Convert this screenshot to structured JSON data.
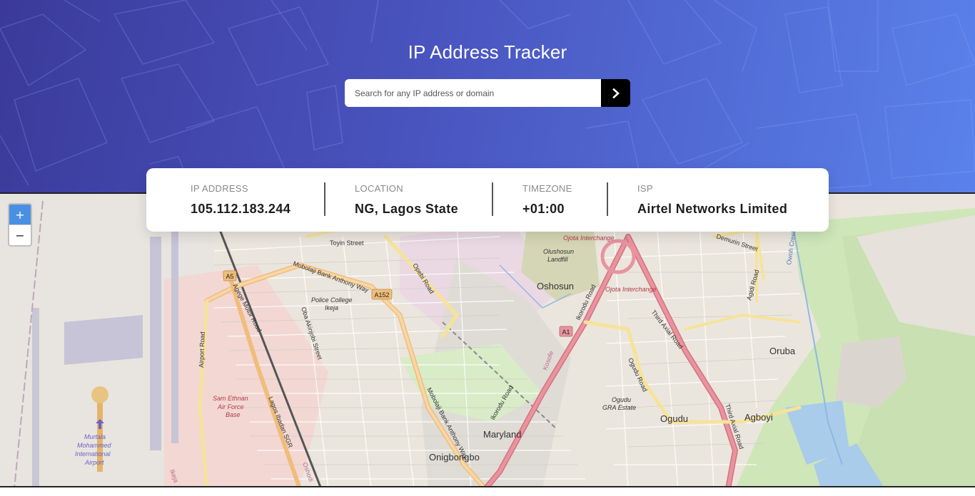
{
  "header": {
    "title": "IP Address Tracker"
  },
  "search": {
    "placeholder": "Search for any IP address or domain",
    "value": "",
    "button_icon": "chevron-right-icon"
  },
  "info": {
    "ip_label": "IP ADDRESS",
    "ip_value": "105.112.183.244",
    "location_label": "LOCATION",
    "location_value": "NG, Lagos State",
    "timezone_label": "TIMEZONE",
    "timezone_value": "+01:00",
    "isp_label": "ISP",
    "isp_value": "Airtel Networks Limited"
  },
  "map": {
    "zoom_in": "+",
    "zoom_out": "−",
    "labels": {
      "toyin_street": "Toyin Street",
      "mobolaji_bank_anthony_way": "Mobolaji Bank Anthony Way",
      "police_college_1": "Police College",
      "police_college_2": "Ikeja",
      "oba_akinjobi_street": "Oba Akinjobi Street",
      "a5": "A5",
      "a152": "A152",
      "a1": "A1",
      "opebi_road": "Opebi Road",
      "oshosun": "Oshosun",
      "olushosun_1": "Olushosun",
      "olushosun_2": "Landfill",
      "ojota_interchange_1": "Ojota Interchange",
      "ojota_interchange_2": "Ojota Interchange",
      "ikorodu_road_1": "Ikorodu Road",
      "ikorodu_road_2": "Ikorodu Road",
      "third_axial_road_1": "Third Axial Road",
      "third_axial_road_2": "Third Axial Road",
      "demurin_street": "Demurin Street",
      "agidi_road": "Agidi Road",
      "oruba": "Oruba",
      "agboyi": "Agboyi",
      "ogudu": "Ogudu",
      "ogudu_road": "Ogudu Road",
      "ogudu_gra_1": "Ogudu",
      "ogudu_gra_2": "GRA Estate",
      "maryland": "Maryland",
      "onigbongbo": "Onigbongbo",
      "mobolaji_bank_anthony_way_2": "Mobolaji Bank Anthony Way",
      "airport_road": "Airport Road",
      "sam_ethnan_1": "Sam Ethnan",
      "sam_ethnan_2": "Air Force",
      "sam_ethnan_3": "Base",
      "murtala_1": "Murtala",
      "murtala_2": "Mohammed",
      "murtala_3": "International",
      "murtala_4": "Airport",
      "agege_motor_road": "Agege Motor Road",
      "lagos_ibadan_sgr": "Lagos Ibadan SGR",
      "kosofe": "Kosofe",
      "ikeja": "Ikeja",
      "oshodi": "Oshodi",
      "owoh_creek": "Owoh Creek"
    }
  },
  "colors": {
    "header_start": "#3b3a9a",
    "header_end": "#5a82ea",
    "search_button": "#000000",
    "value_text": "#1e1e1e",
    "label_text": "#8a8a8a"
  }
}
